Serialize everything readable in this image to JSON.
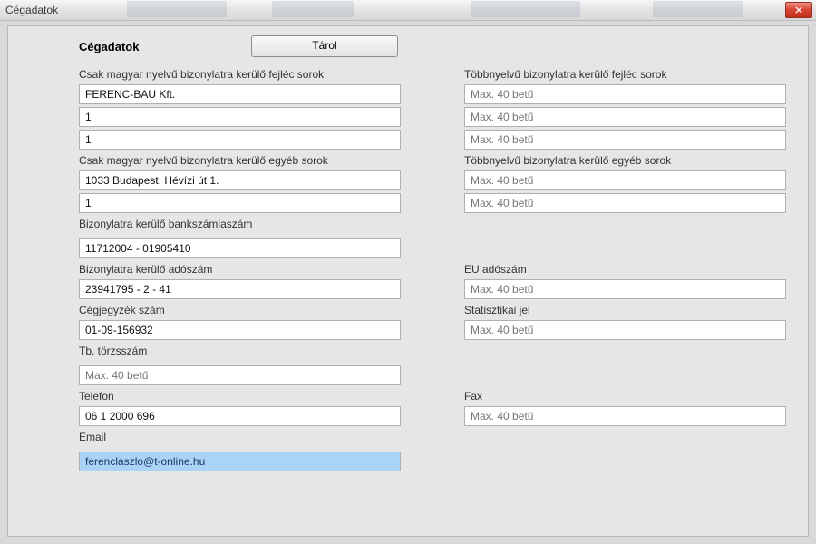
{
  "window": {
    "title": "Cégadatok"
  },
  "header": {
    "title": "Cégadatok",
    "store_button": "Tárol"
  },
  "labels": {
    "hu_header_rows": "Csak magyar nyelvű bizonylatra kerülő fejléc sorok",
    "ml_header_rows": "Többnyelvű bizonylatra kerülő fejléc sorok",
    "hu_other_rows": "Csak magyar nyelvű bizonylatra kerülő egyéb sorok",
    "ml_other_rows": "Többnyelvű bizonylatra kerülő egyéb sorok",
    "bank_account": "Bizonylatra kerülő bankszámlaszám",
    "tax_number": "Bizonylatra kerülő adószám",
    "eu_tax_number": "EU adószám",
    "company_reg": "Cégjegyzék szám",
    "stat_code": "Statisztikai jel",
    "tb_number": "Tb. törzsszám",
    "phone": "Telefon",
    "fax": "Fax",
    "email": "Email"
  },
  "placeholders": {
    "max40": "Max. 40 betű"
  },
  "values": {
    "hu_header_1": "FERENC-BAU Kft.",
    "hu_header_2": "1",
    "hu_header_3": "1",
    "ml_header_1": "",
    "ml_header_2": "",
    "ml_header_3": "",
    "hu_other_1": "1033 Budapest, Hévízi út 1.",
    "hu_other_2": "1",
    "ml_other_1": "",
    "ml_other_2": "",
    "bank_account": "11712004 - 01905410",
    "tax_number": "23941795 - 2 - 41",
    "eu_tax_number": "",
    "company_reg": "01-09-156932",
    "stat_code": "",
    "tb_number": "",
    "phone": "06 1 2000 696",
    "fax": "",
    "email": "ferenclaszlo@t-online.hu"
  }
}
